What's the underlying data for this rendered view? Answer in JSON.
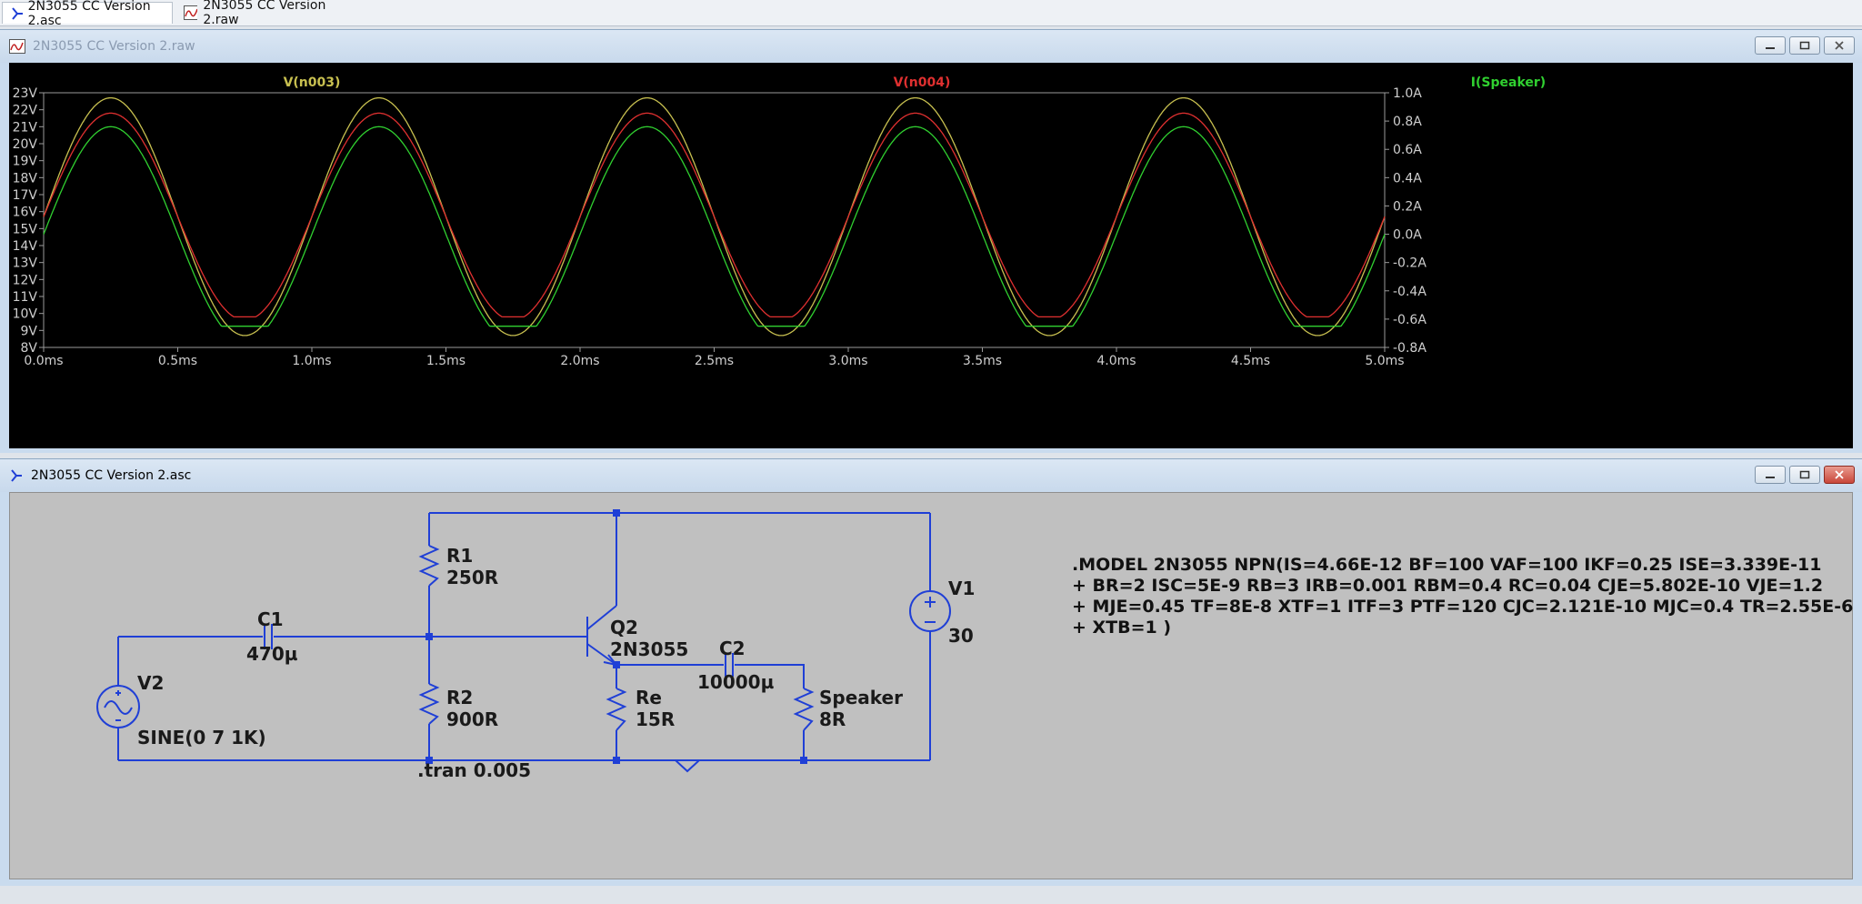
{
  "tabs": [
    {
      "label": "2N3055 CC Version 2.asc",
      "icon": "schematic-icon"
    },
    {
      "label": "2N3055 CC Version 2.raw",
      "icon": "waveform-icon"
    }
  ],
  "plot_window": {
    "title": "2N3055 CC Version 2.raw"
  },
  "schematic_window": {
    "title": "2N3055 CC Version 2.asc"
  },
  "colors": {
    "v_n003": "#c8c050",
    "v_n004": "#e03030",
    "i_speaker": "#30d030",
    "wire": "#1f3fd6"
  },
  "chart_data": {
    "type": "line",
    "title": "",
    "xlabel": "",
    "ylabel": "",
    "xlim": [
      0.0,
      5.0
    ],
    "ylim": [
      8,
      23
    ],
    "y2lim": [
      -0.8,
      1.0
    ],
    "x_ticks": [
      "0.0ms",
      "0.5ms",
      "1.0ms",
      "1.5ms",
      "2.0ms",
      "2.5ms",
      "3.0ms",
      "3.5ms",
      "4.0ms",
      "4.5ms",
      "5.0ms"
    ],
    "y_ticks": [
      "8V",
      "9V",
      "10V",
      "11V",
      "12V",
      "13V",
      "14V",
      "15V",
      "16V",
      "17V",
      "18V",
      "19V",
      "20V",
      "21V",
      "22V",
      "23V"
    ],
    "y2_ticks": [
      "-0.8A",
      "-0.6A",
      "-0.4A",
      "-0.2A",
      "0.0A",
      "0.2A",
      "0.4A",
      "0.6A",
      "0.8A",
      "1.0A"
    ],
    "series": [
      {
        "name": "V(n003)",
        "axis": "left",
        "wave": "sine",
        "offset": 15.7,
        "amplitude": 7.0,
        "freq_khz": 1
      },
      {
        "name": "V(n004)",
        "axis": "left",
        "wave": "sine_clipped",
        "offset": 15.7,
        "amplitude": 6.1,
        "clip_low": 9.8,
        "freq_khz": 1
      },
      {
        "name": "I(Speaker)",
        "axis": "right",
        "wave": "sine_clipped",
        "offset": 0.0,
        "amplitude": 0.76,
        "clip_low": -0.65,
        "freq_khz": 1
      }
    ]
  },
  "schematic": {
    "labels": {
      "r1_name": "R1",
      "r1_value": "250R",
      "r2_name": "R2",
      "r2_value": "900R",
      "c1_name": "C1",
      "c1_value": "470µ",
      "q2_name": "Q2",
      "q2_value": "2N3055",
      "c2_name": "C2",
      "c2_value": "10000µ",
      "re_name": "Re",
      "re_value": "15R",
      "spk_name": "Speaker",
      "spk_value": "8R",
      "v1_name": "V1",
      "v1_value": "30",
      "v2_name": "V2",
      "v2_value": "SINE(0 7 1K)",
      "tran": ".tran 0.005"
    },
    "model_lines": [
      ".MODEL 2N3055 NPN(IS=4.66E-12 BF=100 VAF=100 IKF=0.25 ISE=3.339E-11",
      "+ BR=2 ISC=5E-9 RB=3 IRB=0.001 RBM=0.4 RC=0.04 CJE=5.802E-10 VJE=1.2",
      "+ MJE=0.45 TF=8E-8 XTF=1 ITF=3 PTF=120 CJC=2.121E-10 MJC=0.4 TR=2.55E-6",
      "+ XTB=1 )"
    ]
  }
}
